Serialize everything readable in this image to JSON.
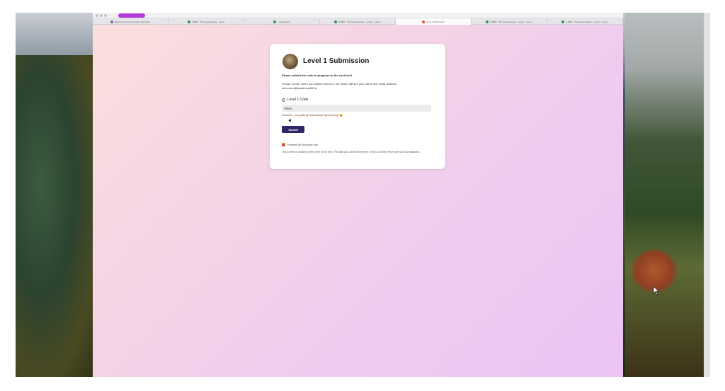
{
  "tabs": [
    {
      "label": "Microsoft Power Automate | My Flows",
      "color": "#6b6f9a"
    },
    {
      "label": "ILMBG - The Great Escape - Home",
      "color": "#3a8a55"
    },
    {
      "label": "Leaderboard",
      "color": "#3a8a55"
    },
    {
      "label": "ILMBG - The Great Escape - Level 1 - Home",
      "color": "#3a8a55"
    },
    {
      "label": "Level 1 Submission",
      "color": "#e0552f",
      "active": true
    },
    {
      "label": "ILMBG - The Great Escape - Level 2 - Home",
      "color": "#3a8a55"
    },
    {
      "label": "ILMBG - The Great Escape - Level 3 - Home",
      "color": "#3a8a55"
    }
  ],
  "form": {
    "title": "Level 1 Submission",
    "subtitle": "Please submit the code to progress to the next level",
    "notice": "Hi Dan Carroll, when you submit this form, the owner will see your name and email address dan.carroll@academy365.io",
    "field_label": "Level 1 Code",
    "field_value": "Silver",
    "error": "Incorrect... you gotta get that answer right Dummy! 😜",
    "submit_label": "Submit",
    "powered_by": "Powered by Microsoft Lists",
    "disclaimer": "This content is created by the owner of the form. The data you submit will be sent to the List owner. Never give out your password."
  }
}
